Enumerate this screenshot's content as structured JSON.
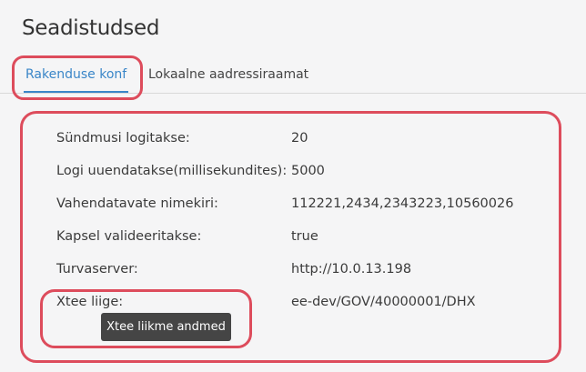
{
  "page": {
    "title": "Seadistudsed"
  },
  "tabs": [
    {
      "label": "Rakenduse konf",
      "active": true
    },
    {
      "label": "Lokaalne aadressiraamat",
      "active": false
    }
  ],
  "settings": [
    {
      "label": "Sündmusi logitakse:",
      "value": "20"
    },
    {
      "label": "Logi uuendatakse(millisekundites):",
      "value": "5000"
    },
    {
      "label": "Vahendatavate nimekiri:",
      "value": "112221,2434,2343223,10560026"
    },
    {
      "label": "Kapsel valideeritakse:",
      "value": "true"
    },
    {
      "label": "Turvaserver:",
      "value": "http://10.0.13.198"
    },
    {
      "label": "Xtee liige:",
      "value": "ee-dev/GOV/40000001/DHX"
    }
  ],
  "tooltip": {
    "text": "Xtee liikme andmed"
  },
  "colors": {
    "accent": "#3a86c8",
    "highlight": "#dd4c5c",
    "tooltip_bg": "#454545",
    "background": "#f5f5f6"
  }
}
